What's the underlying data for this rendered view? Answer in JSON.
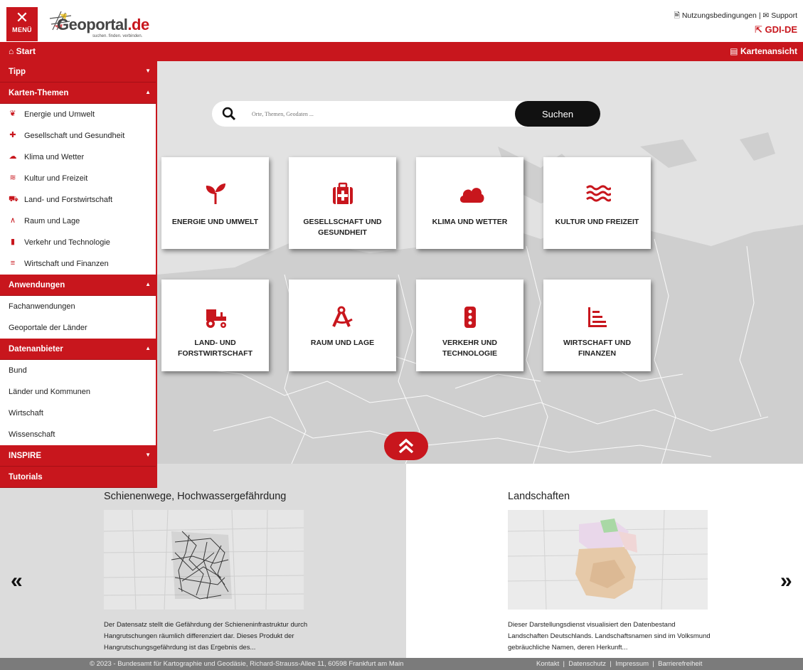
{
  "header": {
    "menu_label": "MENÜ",
    "logo_brand": "Geoportal",
    "logo_tld": ".de",
    "logo_tagline": "suchen. finden. verbinden.",
    "nutzung": "Nutzungsbedingungen",
    "sep": "|",
    "support": "Support",
    "gdi": "GDI-DE"
  },
  "bar": {
    "start": "Start",
    "kartenansicht": "Kartenansicht"
  },
  "sidebar": {
    "tipp": "Tipp",
    "karten_themen": "Karten-Themen",
    "themes": [
      "Energie und Umwelt",
      "Gesellschaft und Gesundheit",
      "Klima und Wetter",
      "Kultur und Freizeit",
      "Land- und Forstwirtschaft",
      "Raum und Lage",
      "Verkehr und Technologie",
      "Wirtschaft und Finanzen"
    ],
    "anwendungen": "Anwendungen",
    "anwendungen_items": [
      "Fachanwendungen",
      "Geoportale der Länder"
    ],
    "datenanbieter": "Datenanbieter",
    "datenanbieter_items": [
      "Bund",
      "Länder und Kommunen",
      "Wirtschaft",
      "Wissenschaft"
    ],
    "inspire": "INSPIRE",
    "tutorials": "Tutorials"
  },
  "search": {
    "placeholder": "Orte, Themen, Geodaten ...",
    "button": "Suchen"
  },
  "tiles": [
    "ENERGIE UND UMWELT",
    "GESELLSCHAFT UND GESUNDHEIT",
    "KLIMA UND WETTER",
    "KULTUR UND FREIZEIT",
    "LAND- UND FORSTWIRTSCHAFT",
    "RAUM UND LAGE",
    "VERKEHR UND TECHNOLOGIE",
    "WIRTSCHAFT UND FINANZEN"
  ],
  "cards": [
    {
      "title": "Schienenwege, Hochwassergefährdung",
      "desc": "Der Datensatz stellt die Gefährdung der Schieneninfrastruktur durch Hangrutschungen räumlich differenziert dar. Dieses Produkt der Hangrutschungsgefährdung ist das Ergebnis des..."
    },
    {
      "title": "Landschaften",
      "desc": "Dieser Darstellungsdienst visualisiert den Datenbestand Landschaften Deutschlands. Landschaftsnamen sind im Volksmund gebräuchliche Namen, deren Herkunft..."
    }
  ],
  "carousel": {
    "prev": "«",
    "next": "»"
  },
  "footer": {
    "copyright": "© 2023 - Bundesamt für Kartographie und Geodäsie, Richard-Strauss-Allee 11, 60598 Frankfurt am Main",
    "links": [
      "Kontakt",
      "Datenschutz",
      "Impressum",
      "Barrierefreiheit"
    ]
  },
  "colors": {
    "brand_red": "#c8161d",
    "map_land": "#cfcfcf",
    "map_water": "#e2e2e2"
  }
}
